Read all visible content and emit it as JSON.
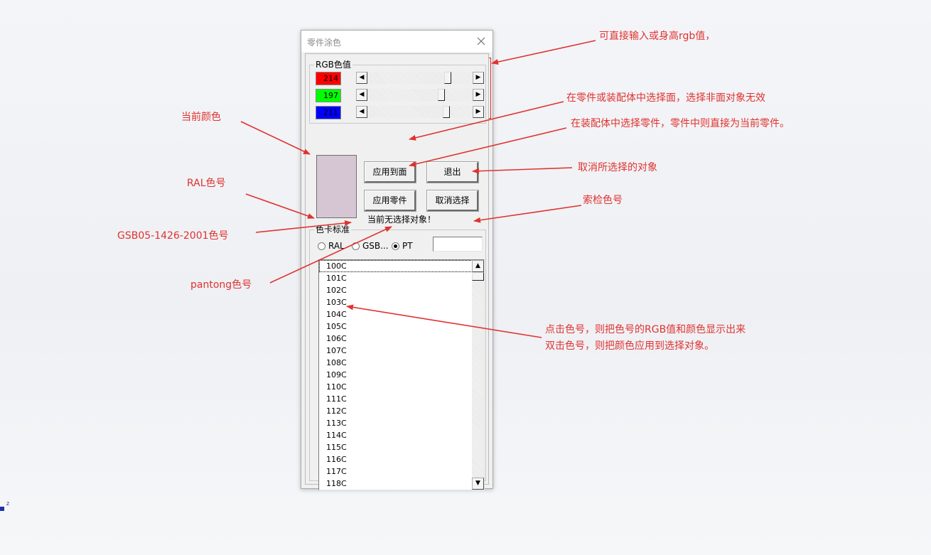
{
  "dialog": {
    "title": "零件涂色",
    "rgb_group_label": "RGB色值",
    "rgb": [
      {
        "label": "214",
        "color": "#ff0000",
        "thumb_fraction": 0.78
      },
      {
        "label": "197",
        "color": "#00ff00",
        "thumb_fraction": 0.72
      },
      {
        "label": "211",
        "color": "#0000ff",
        "thumb_fraction": 0.77
      }
    ],
    "current_color": "#d6c5d3",
    "buttons": {
      "apply_face": "应用到面",
      "exit": "退出",
      "apply_part": "应用零件",
      "cancel_select": "取消选择"
    },
    "status": "当前无选择对象！",
    "card_group_label": "色卡标准",
    "radios": [
      {
        "label": "RAL",
        "checked": false
      },
      {
        "label": "GSB...",
        "checked": false
      },
      {
        "label": "PT",
        "checked": true
      }
    ],
    "search_value": "",
    "list": [
      "100C",
      "101C",
      "102C",
      "103C",
      "104C",
      "105C",
      "106C",
      "107C",
      "108C",
      "109C",
      "110C",
      "111C",
      "112C",
      "113C",
      "114C",
      "115C",
      "116C",
      "117C",
      "118C"
    ]
  },
  "annotations": {
    "rgb_input": "可直接输入或身高rgb值，",
    "apply_face": "在零件或装配体中选择面，选择非面对象无效",
    "apply_part": "在装配体中选择零件，零件中则直接为当前零件。",
    "cancel": "取消所选择的对象",
    "current_color": "当前颜色",
    "ral": "RAL色号",
    "gsb": "GSB05-1426-2001色号",
    "pantong": "pantong色号",
    "search": "索检色号",
    "list_line1": "点击色号，则把色号的RGB值和颜色显示出来",
    "list_line2": "双击色号，则把颜色应用到选择对象。"
  },
  "axis_label": "z",
  "accent_color": "#e0322f"
}
